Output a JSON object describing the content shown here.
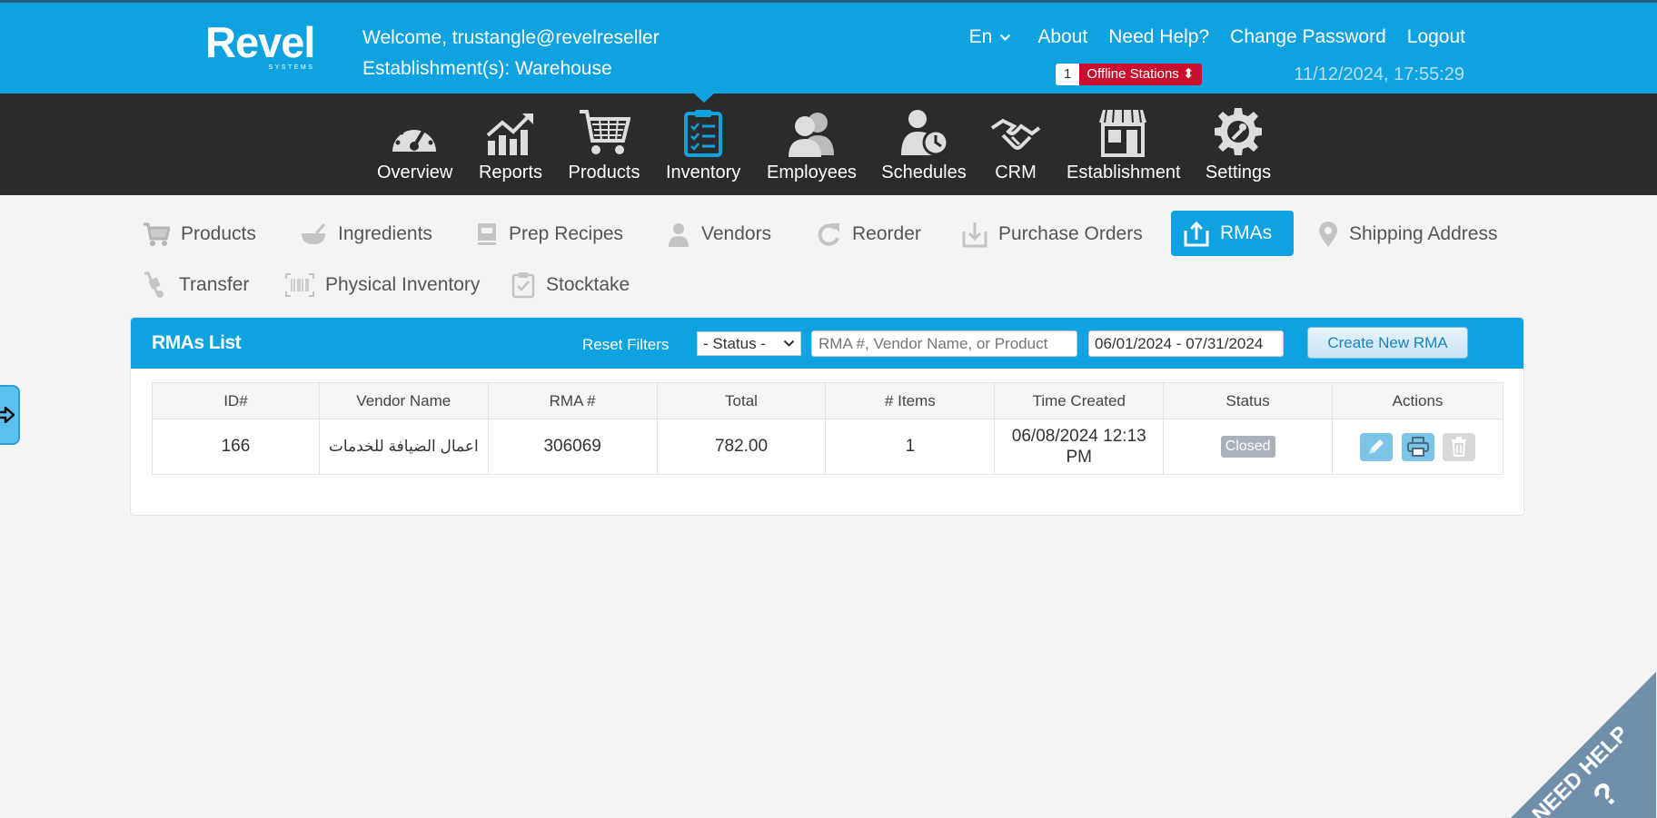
{
  "header": {
    "logo": "Revel",
    "logo_sub": "SYSTEMS",
    "welcome": "Welcome, trustangle@revelreseller",
    "establishment": "Establishment(s): Warehouse",
    "lang": "En",
    "links": [
      "About",
      "Need Help?",
      "Change Password",
      "Logout"
    ],
    "offline_count": "1",
    "offline_label": "Offline Stations",
    "datetime": "11/12/2024, 17:55:29"
  },
  "mainnav": [
    {
      "label": "Overview",
      "icon": "speedometer-icon"
    },
    {
      "label": "Reports",
      "icon": "chart-icon"
    },
    {
      "label": "Products",
      "icon": "cart-icon"
    },
    {
      "label": "Inventory",
      "icon": "clipboard-icon",
      "active": true
    },
    {
      "label": "Employees",
      "icon": "people-icon"
    },
    {
      "label": "Schedules",
      "icon": "person-clock-icon"
    },
    {
      "label": "CRM",
      "icon": "handshake-icon"
    },
    {
      "label": "Establishment",
      "icon": "store-icon"
    },
    {
      "label": "Settings",
      "icon": "gear-icon"
    }
  ],
  "subnav": [
    {
      "label": "Products",
      "icon": "cart-icon"
    },
    {
      "label": "Ingredients",
      "icon": "bowl-icon"
    },
    {
      "label": "Prep Recipes",
      "icon": "recipe-book-icon"
    },
    {
      "label": "Vendors",
      "icon": "person-icon"
    },
    {
      "label": "Reorder",
      "icon": "redo-icon"
    },
    {
      "label": "Purchase Orders",
      "icon": "download-tray-icon"
    },
    {
      "label": "RMAs",
      "icon": "upload-tray-icon",
      "active": true
    },
    {
      "label": "Shipping Address",
      "icon": "map-pin-icon"
    },
    {
      "label": "Transfer",
      "icon": "hand-truck-icon"
    },
    {
      "label": "Physical Inventory",
      "icon": "barcode-icon"
    },
    {
      "label": "Stocktake",
      "icon": "checklist-icon"
    }
  ],
  "panel": {
    "title": "RMAs List",
    "reset": "Reset Filters",
    "status_select": "- Status -",
    "search_placeholder": "RMA #, Vendor Name, or Product",
    "date_range": "06/01/2024 - 07/31/2024",
    "create_label": "Create New RMA"
  },
  "table": {
    "columns": [
      "ID#",
      "Vendor Name",
      "RMA #",
      "Total",
      "# Items",
      "Time Created",
      "Status",
      "Actions"
    ],
    "rows": [
      {
        "id": "166",
        "vendor": "اعمال الضيافة للخدمات",
        "rma": "306069",
        "total": "782.00",
        "items": "1",
        "created": "06/08/2024 12:13 PM",
        "status": "Closed"
      }
    ]
  },
  "help_tab": "NEED HELP",
  "colors": {
    "brand": "#0ea3e0",
    "nav_dark": "#2b2b2b",
    "offline_red": "#c8102e"
  }
}
